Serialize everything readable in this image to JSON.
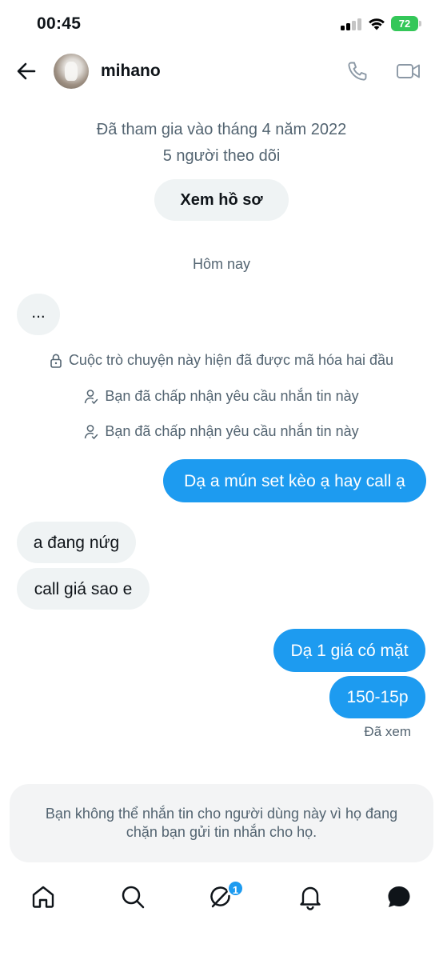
{
  "status_bar": {
    "time": "00:45",
    "battery": "72"
  },
  "header": {
    "username": "mihano"
  },
  "profile": {
    "joined": "Đã tham gia vào tháng 4 năm 2022",
    "followers": "5 người theo dõi",
    "view_profile": "Xem hồ sơ"
  },
  "date_separator": "Hôm nay",
  "messages": [
    {
      "direction": "in",
      "text": "..."
    },
    {
      "direction": "out",
      "text": "Dạ a mún set kèo ạ hay call ạ"
    },
    {
      "direction": "in",
      "text": "a đang nứg"
    },
    {
      "direction": "in",
      "text": "call giá sao e"
    },
    {
      "direction": "out",
      "text": "Dạ 1 giá có mặt"
    },
    {
      "direction": "out",
      "text": "150-15p"
    }
  ],
  "system_notices": {
    "encrypted": "Cuộc trò chuyện này hiện đã được mã hóa hai đầu",
    "accepted_1": "Bạn đã chấp nhận yêu cầu nhắn tin này",
    "accepted_2": "Bạn đã chấp nhận yêu cầu nhắn tin này"
  },
  "seen_status": "Đã xem",
  "blocked_notice": "Bạn không thể nhắn tin cho người dùng này vì họ đang chặn bạn gửi tin nhắn cho họ.",
  "tabbar": {
    "items": [
      "home-icon",
      "search-icon",
      "grok-icon",
      "notifications-icon",
      "messages-icon"
    ],
    "badge": "1"
  },
  "colors": {
    "accent": "#1d9bf0",
    "muted": "#536471",
    "bubble_in": "#eff3f4"
  }
}
